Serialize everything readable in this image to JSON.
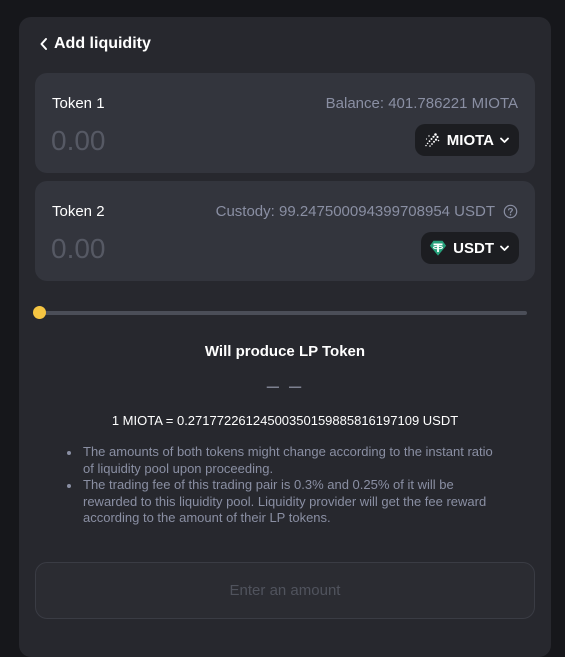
{
  "header": {
    "title": "Add liquidity"
  },
  "token1": {
    "label": "Token 1",
    "balance": "Balance: 401.786221 MIOTA",
    "placeholder": "0.00",
    "symbol": "MIOTA"
  },
  "token2": {
    "label": "Token 2",
    "custody": "Custody: 99.247500094399708954 USDT",
    "placeholder": "0.00",
    "symbol": "USDT"
  },
  "slider": {
    "value_percent": 0
  },
  "lp": {
    "title": "Will produce LP Token",
    "value": "– –"
  },
  "rate": "1 MIOTA = 0.27177226124500350159885816197109 USDT",
  "notes": [
    "The amounts of both tokens might change according to the instant ratio of liquidity pool upon proceeding.",
    "The trading fee of this trading pair is 0.3% and 0.25% of it will be rewarded to this liquidity pool. Liquidity provider will get the fee reward according to the amount of their LP tokens."
  ],
  "submit_label": "Enter an amount",
  "colors": {
    "accent": "#f5c542",
    "panel": "#27282e",
    "card": "#33353d",
    "muted_text": "#8a8fa3",
    "usdt": "#26a17b"
  },
  "icons": {
    "back": "chevron-left-icon",
    "help": "question-circle-icon",
    "miota_logo": "iota-logo-icon",
    "usdt_logo": "tether-logo-icon",
    "dropdown": "chevron-down-icon"
  }
}
